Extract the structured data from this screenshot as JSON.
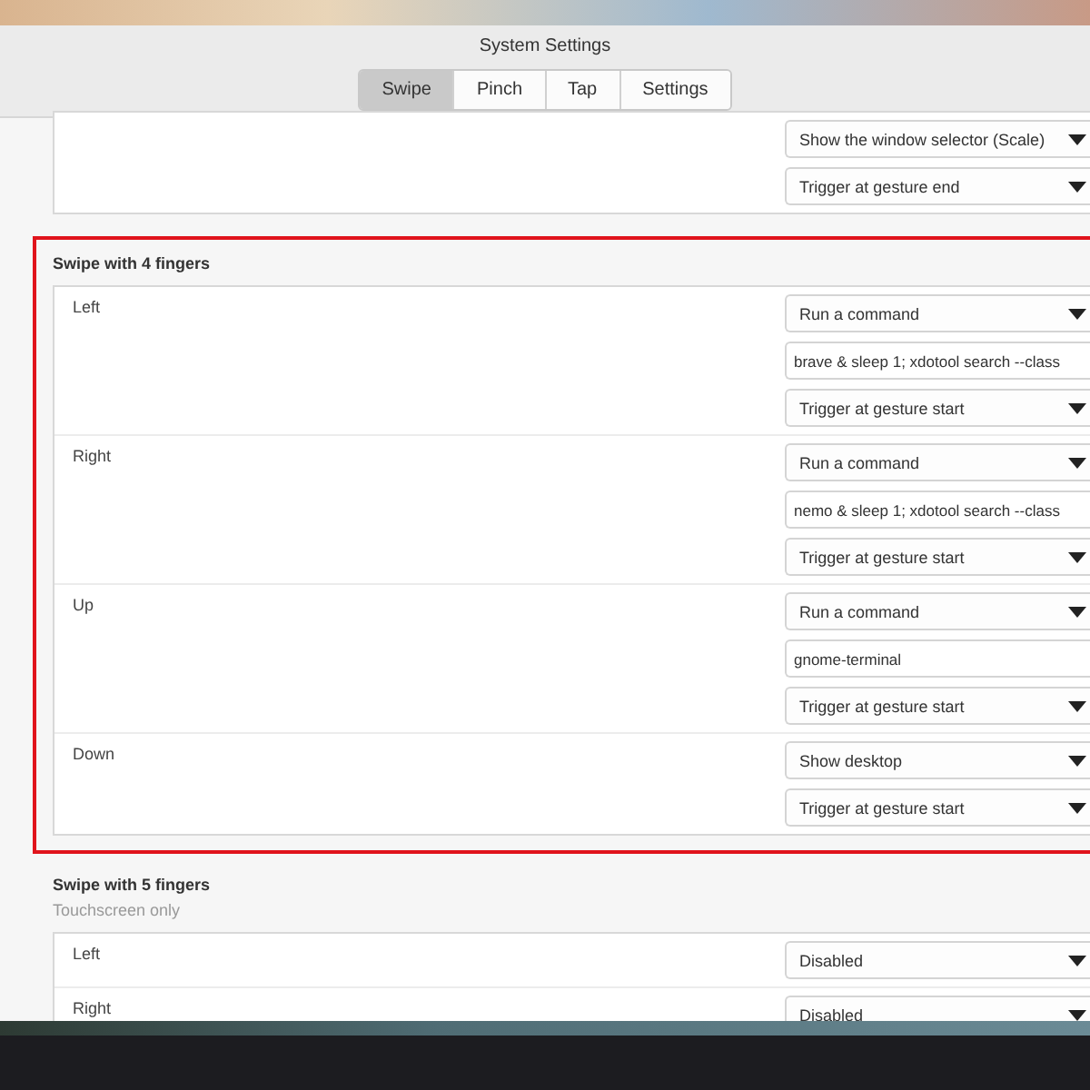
{
  "window": {
    "title": "System Settings"
  },
  "tabs": [
    {
      "label": "Swipe",
      "selected": true
    },
    {
      "label": "Pinch",
      "selected": false
    },
    {
      "label": "Tap",
      "selected": false
    },
    {
      "label": "Settings",
      "selected": false
    }
  ],
  "sections": [
    {
      "highlighted": false,
      "rows": [
        {
          "controls": [
            {
              "kind": "select",
              "value": "Show the window selector (Scale)"
            },
            {
              "kind": "select",
              "value": "Trigger at gesture end"
            }
          ]
        }
      ]
    },
    {
      "title": "Swipe with 4 fingers",
      "highlighted": true,
      "rows": [
        {
          "label": "Left",
          "controls": [
            {
              "kind": "select",
              "value": "Run a command"
            },
            {
              "kind": "entry",
              "value": "brave & sleep 1; xdotool search --class"
            },
            {
              "kind": "select",
              "value": "Trigger at gesture start"
            }
          ]
        },
        {
          "label": "Right",
          "controls": [
            {
              "kind": "select",
              "value": "Run a command"
            },
            {
              "kind": "entry",
              "value": "nemo & sleep 1; xdotool search --class"
            },
            {
              "kind": "select",
              "value": "Trigger at gesture start"
            }
          ]
        },
        {
          "label": "Up",
          "controls": [
            {
              "kind": "select",
              "value": "Run a command"
            },
            {
              "kind": "entry",
              "value": "gnome-terminal"
            },
            {
              "kind": "select",
              "value": "Trigger at gesture start"
            }
          ]
        },
        {
          "label": "Down",
          "controls": [
            {
              "kind": "select",
              "value": "Show desktop"
            },
            {
              "kind": "select",
              "value": "Trigger at gesture start"
            }
          ]
        }
      ]
    },
    {
      "title": "Swipe with 5 fingers",
      "subtitle": "Touchscreen only",
      "highlighted": false,
      "rows": [
        {
          "label": "Left",
          "controls": [
            {
              "kind": "select",
              "value": "Disabled"
            }
          ]
        },
        {
          "label": "Right",
          "controls": [
            {
              "kind": "select",
              "value": "Disabled"
            }
          ]
        }
      ]
    }
  ]
}
